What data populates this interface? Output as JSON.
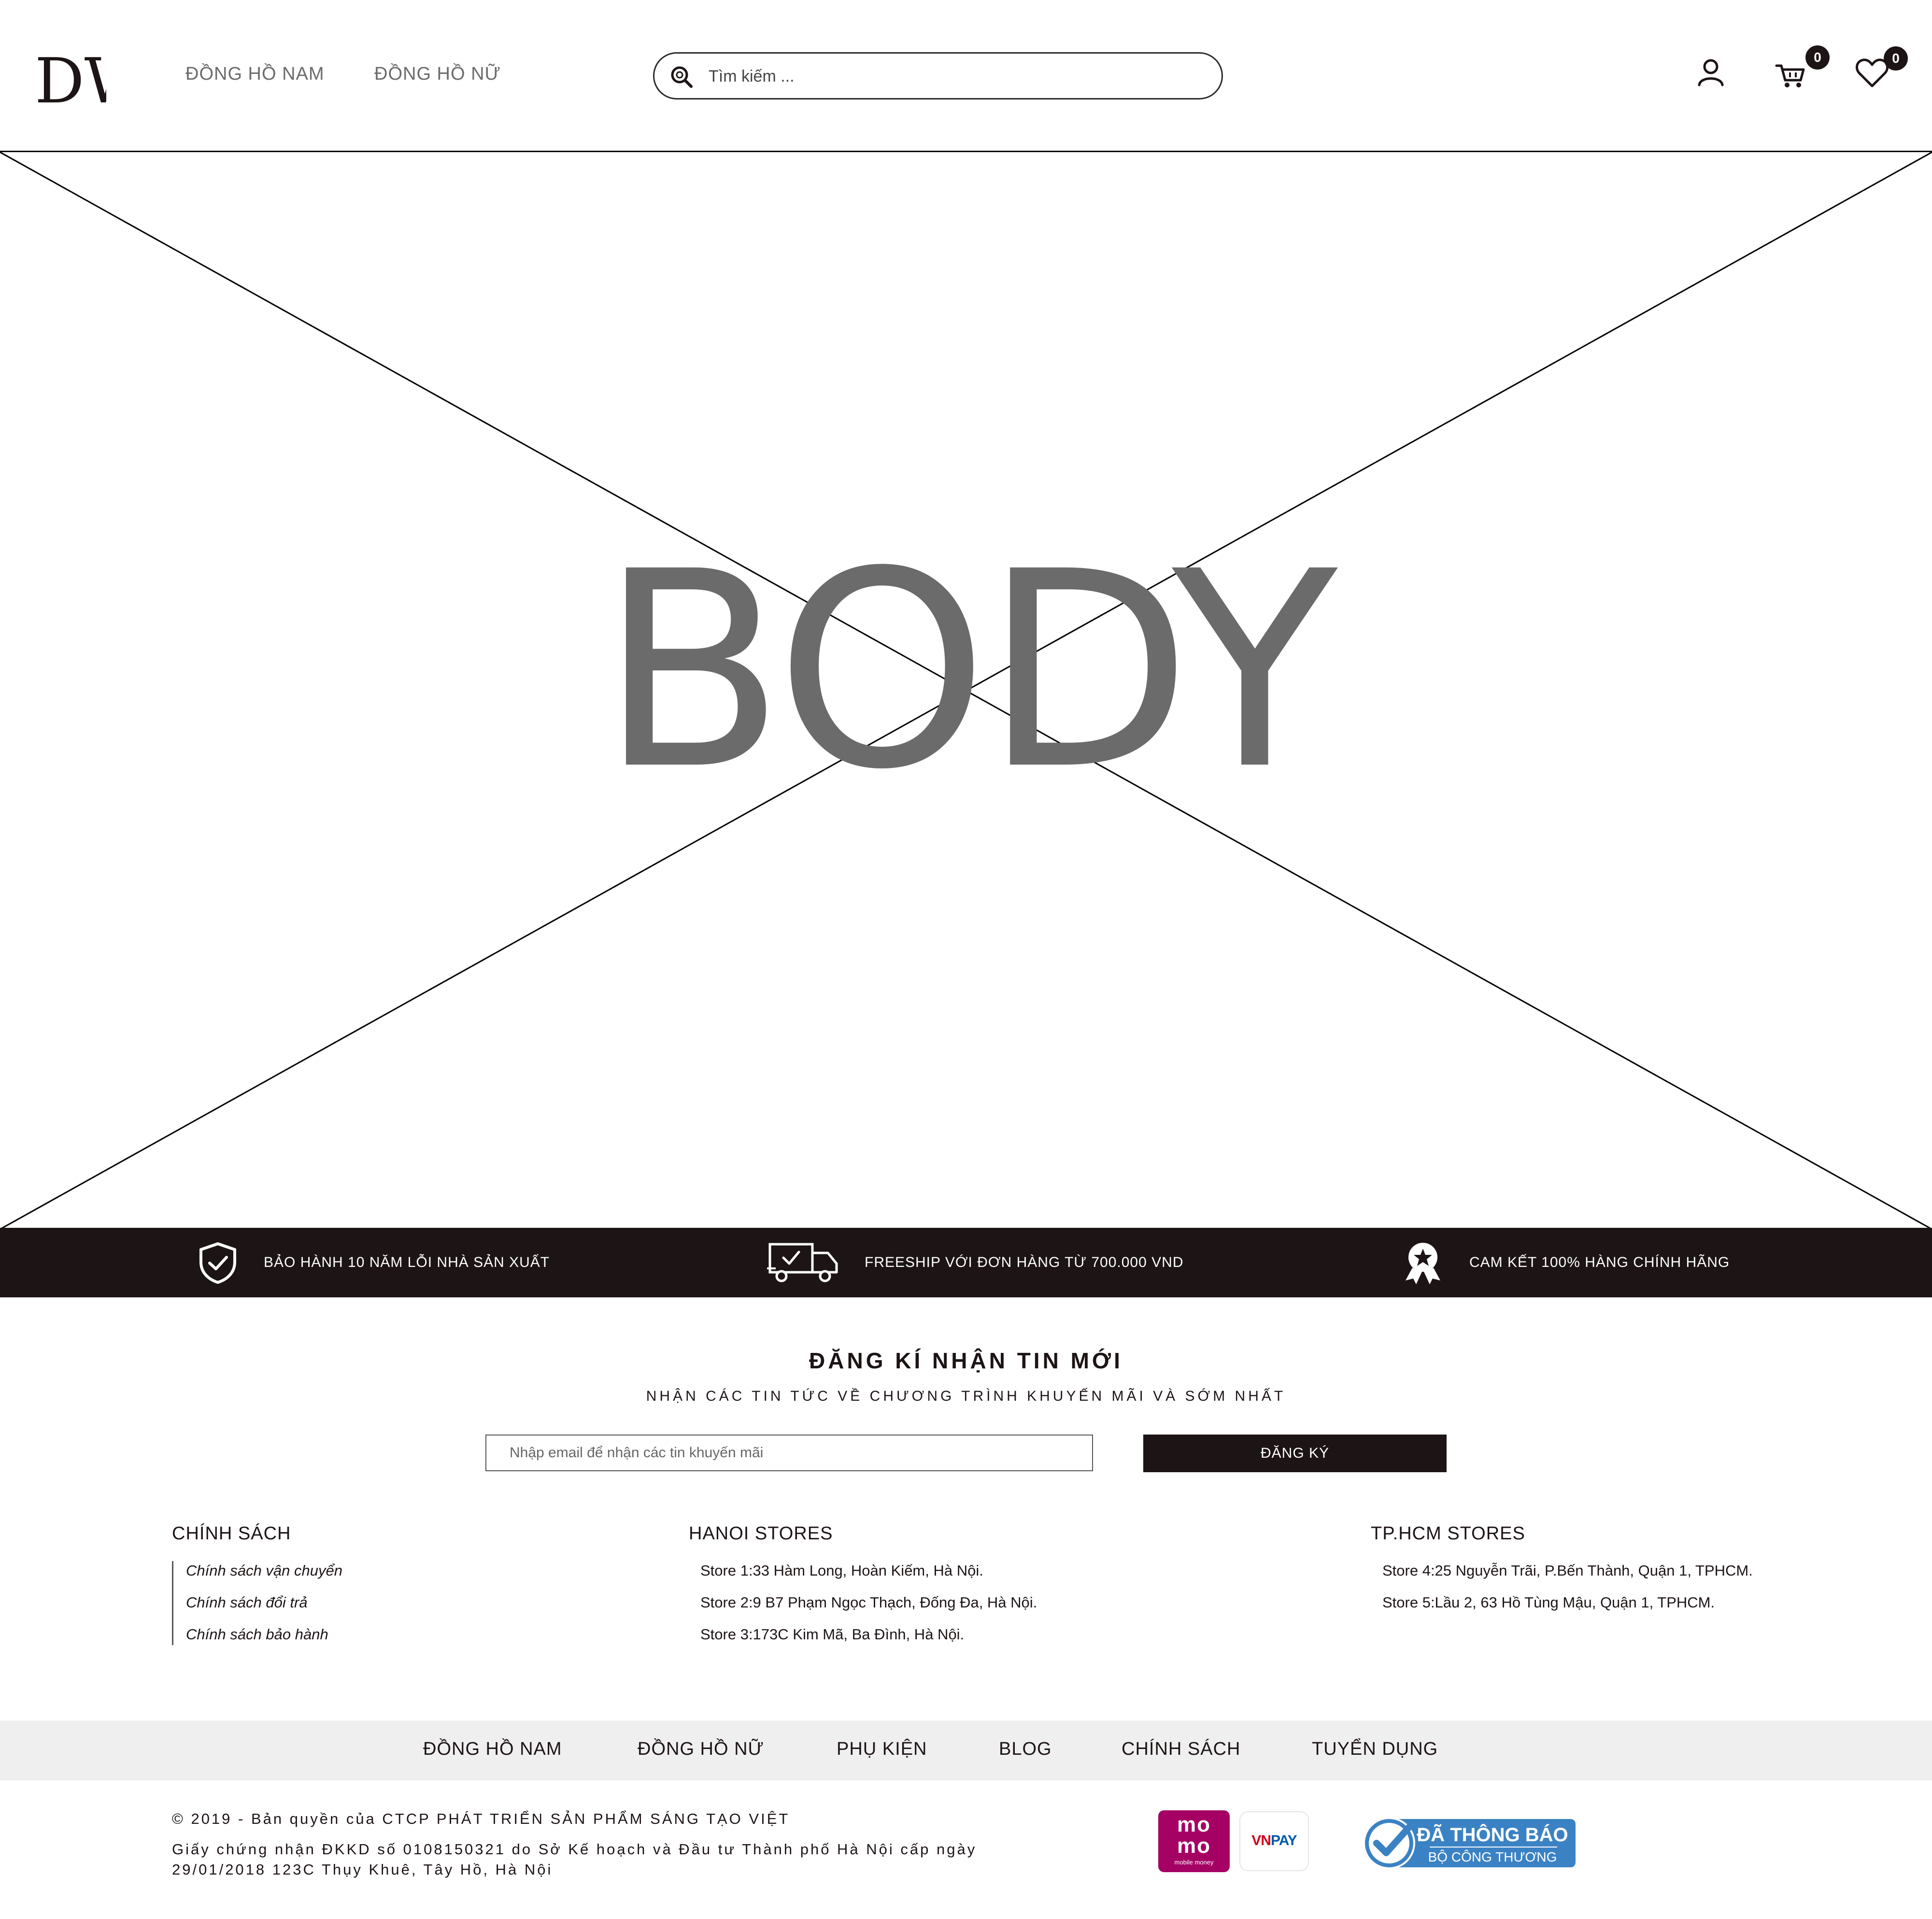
{
  "header": {
    "logo_text": "DW",
    "nav": [
      {
        "label": "ĐỒNG HỒ NAM"
      },
      {
        "label": "ĐỒNG HỒ NỮ"
      }
    ],
    "search": {
      "placeholder": "Tìm kiếm ..."
    },
    "cart_count": "0",
    "wishlist_count": "0",
    "icons": [
      "search-icon",
      "user-icon",
      "cart-icon",
      "heart-icon"
    ]
  },
  "body_placeholder": {
    "label": "BODY"
  },
  "benefits": [
    {
      "icon": "shield-check-icon",
      "label": "BẢO HÀNH 10 NĂM LỖI NHÀ SẢN XUẤT"
    },
    {
      "icon": "delivery-truck-icon",
      "label": "FREESHIP VỚI ĐƠN HÀNG TỪ 700.000 VND"
    },
    {
      "icon": "award-badge-icon",
      "label": "CAM KẾT 100% HÀNG CHÍNH HÃNG"
    }
  ],
  "newsletter": {
    "title": "ĐĂNG KÍ NHẬN TIN MỚI",
    "subtitle": "NHẬN CÁC TIN TỨC VỀ CHƯƠNG TRÌNH KHUYẾN MÃI VÀ SỚM NHẤT",
    "input_placeholder": "Nhập email để nhận các tin khuyến mãi",
    "button_label": "ĐĂNG KÝ"
  },
  "footer": {
    "policy": {
      "title": "CHÍNH SÁCH",
      "items": [
        "Chính sách vận chuyển",
        "Chính sách đổi trả",
        "Chính sách bảo hành"
      ]
    },
    "hanoi": {
      "title": "HANOI STORES",
      "items": [
        "Store 1:33 Hàm Long, Hoàn Kiếm, Hà Nội.",
        "Store 2:9 B7 Phạm Ngọc Thạch, Đống Đa, Hà Nội.",
        "Store 3:173C Kim Mã, Ba Đình, Hà Nội."
      ]
    },
    "hcm": {
      "title": "TP.HCM STORES",
      "items": [
        "Store 4:25 Nguyễn Trãi, P.Bến Thành, Quận 1, TPHCM.",
        "Store 5:Lầu 2, 63 Hồ Tùng Mậu, Quận 1, TPHCM."
      ]
    },
    "bottom_nav": [
      "ĐỒNG HỒ NAM",
      "ĐỒNG HỒ NỮ",
      "PHỤ KIỆN",
      "BLOG",
      "CHÍNH SÁCH",
      "TUYỂN DỤNG"
    ],
    "copyright": "© 2019 - Bản quyền của CTCP PHÁT TRIỂN SẢN PHẨM SÁNG TẠO VIỆT",
    "license": "Giấy chứng nhận ĐKKD số 0108150321 do Sở Kế hoạch và Đầu tư Thành phố Hà Nội cấp ngày 29/01/2018 123C Thụy Khuê, Tây Hồ, Hà Nội",
    "payment_logos": {
      "momo_text": "mo mo",
      "momo_sub": "mobile money",
      "vnpay_vn": "VN",
      "vnpay_pay": "PAY"
    },
    "bct_badge": {
      "line1": "ĐÃ THÔNG BÁO",
      "line2": "BỘ CÔNG THƯƠNG"
    }
  },
  "colors": {
    "dark": "#1d1415",
    "nav_gray": "#6b6b6b",
    "bottom_nav_bg": "#efefef",
    "momo": "#a50064",
    "vnpay_red": "#d0021b",
    "vnpay_blue": "#005baa",
    "bct_blue": "#3b82c4"
  }
}
